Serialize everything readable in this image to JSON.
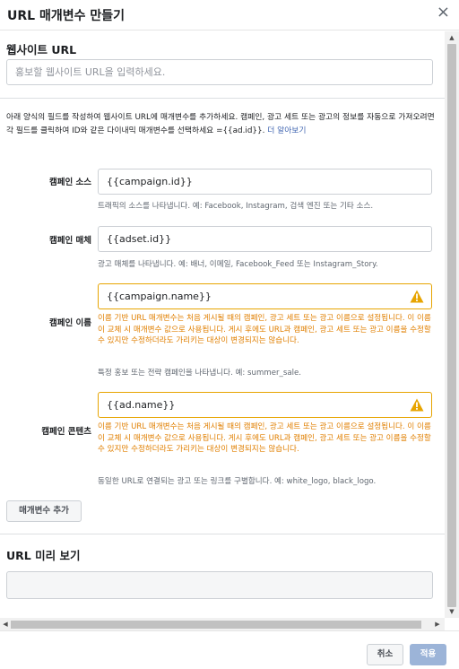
{
  "dialog": {
    "title": "URL 매개변수 만들기",
    "close_glyph": "×"
  },
  "website": {
    "label": "웹사이트 URL",
    "placeholder": "홍보할 웹사이트 URL을 입력하세요."
  },
  "description": {
    "text": "아래 양식의 필드를 작성하여 웹사이트 URL에 매개변수를 추가하세요. 캠페인, 광고 세트 또는 광고의 정보를 자동으로 가져오려면 각 필드를 클릭하여 ID와 같은 다이내믹 매개변수를 선택하세요 ={{ad.id}}.",
    "link": "더 알아보기"
  },
  "fields": [
    {
      "label": "캠페인 소스",
      "value": "{{campaign.id}}",
      "help": "트래픽의 소스를 나타냅니다. 예: Facebook, Instagram, 검색 엔진 또는 기타 소스.",
      "warning": null
    },
    {
      "label": "캠페인 매체",
      "value": "{{adset.id}}",
      "help": "광고 매체를 나타냅니다. 예: 배너, 이메일, Facebook_Feed 또는 Instagram_Story.",
      "warning": null
    },
    {
      "label": "캠페인 이름",
      "value": "{{campaign.name}}",
      "help": "특정 홍보 또는 전략 캠페인을 나타냅니다. 예: summer_sale.",
      "warning": "이름 기반 URL 매개변수는 처음 게시될 때의 캠페인, 광고 세트 또는 광고 이름으로 설정됩니다. 이 이름이 교체 시 매개변수 값으로 사용됩니다. 게시 후에도 URL과 캠페인, 광고 세트 또는 광고 이름을 수정할 수 있지만 수정하더라도 가리키는 대상이 변경되지는 않습니다."
    },
    {
      "label": "캠페인 콘텐츠",
      "value": "{{ad.name}}",
      "help": "동일한 URL로 연결되는 광고 또는 링크를 구별합니다. 예: white_logo, black_logo.",
      "warning": "이름 기반 URL 매개변수는 처음 게시될 때의 캠페인, 광고 세트 또는 광고 이름으로 설정됩니다. 이 이름이 교체 시 매개변수 값으로 사용됩니다. 게시 후에도 URL과 캠페인, 광고 세트 또는 광고 이름을 수정할 수 있지만 수정하더라도 가리키는 대상이 변경되지는 않습니다."
    }
  ],
  "add_param_label": "매개변수 추가",
  "preview": {
    "label": "URL 미리 보기",
    "value": ""
  },
  "footer": {
    "cancel_label": "취소",
    "apply_label": "적용"
  },
  "colors": {
    "warning": "#e7a400",
    "warning_text": "#e07f00",
    "link": "#4267b2",
    "primary_disabled": "#9cb4d8"
  }
}
